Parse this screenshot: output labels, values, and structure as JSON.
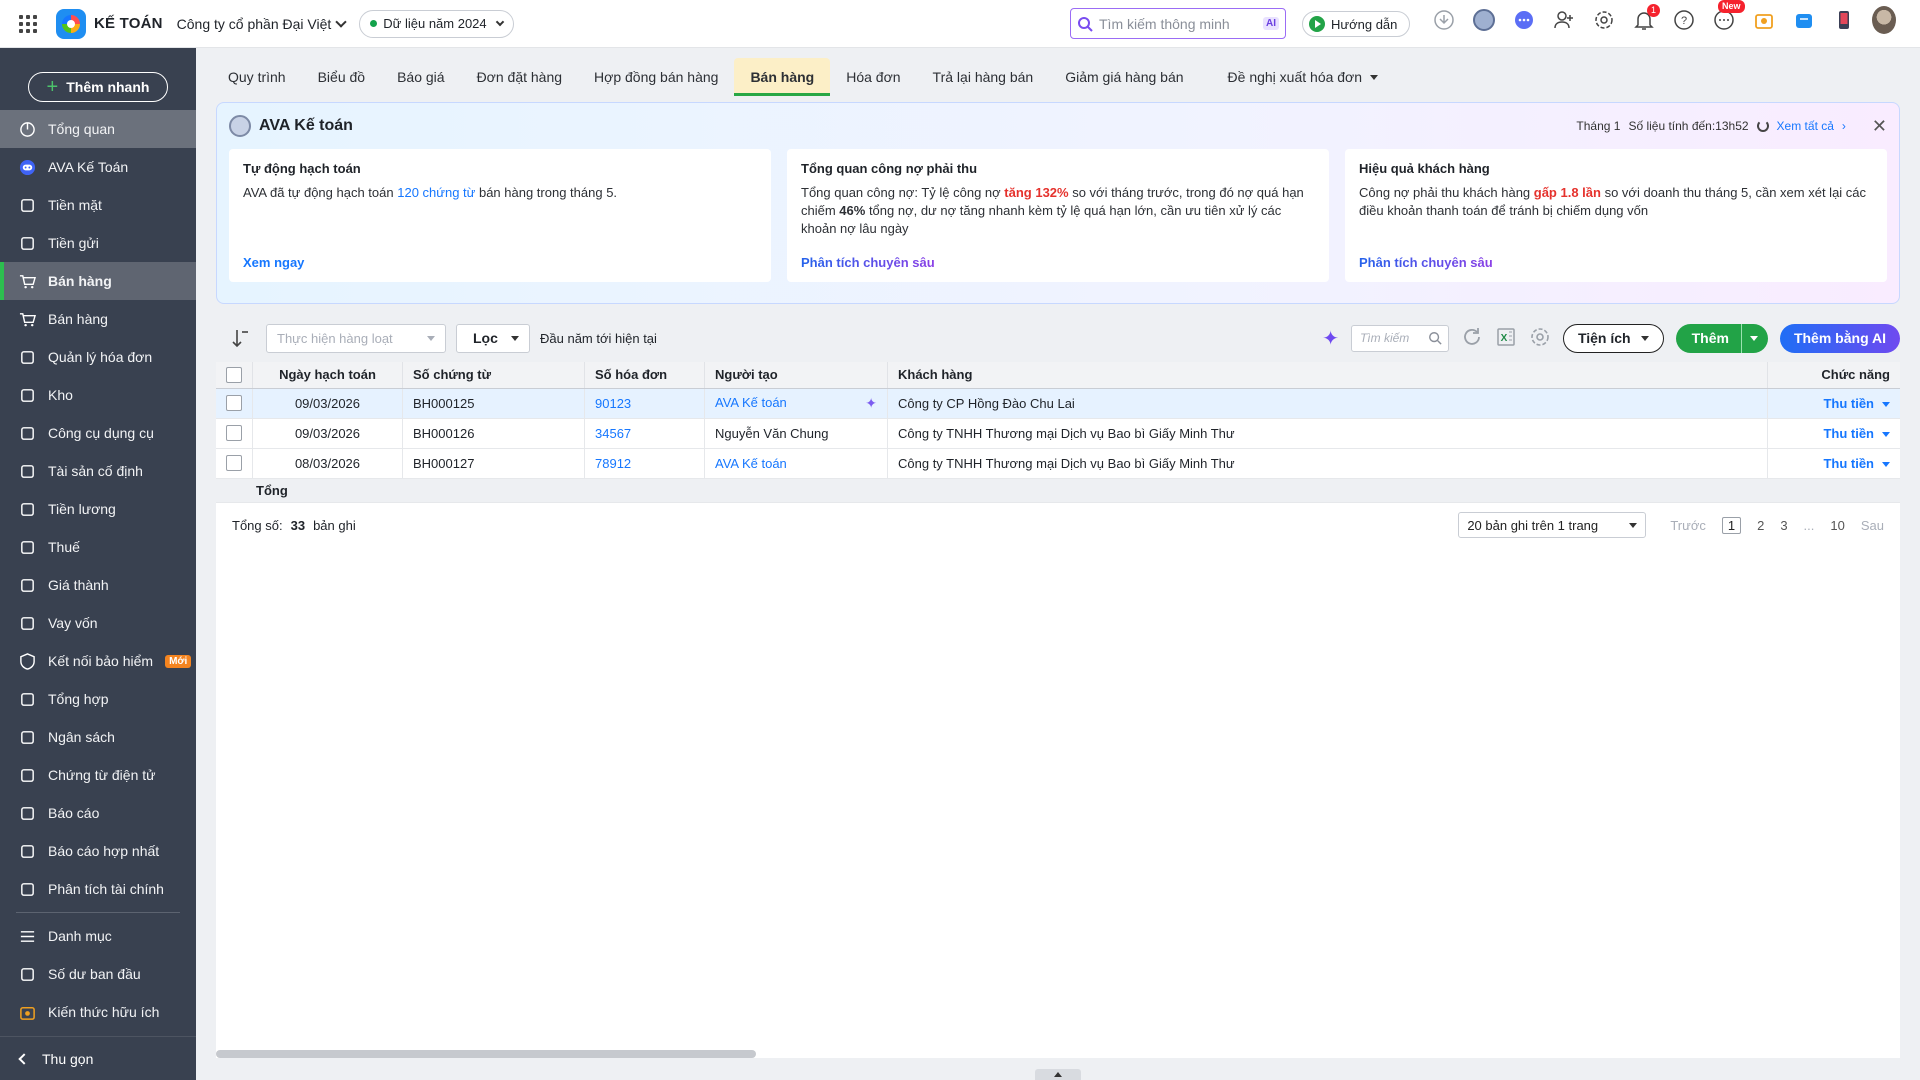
{
  "header": {
    "app_name": "KẾ TOÁN",
    "company": "Công ty cổ phần Đại Việt",
    "data_year": "Dữ liệu năm 2024",
    "search_placeholder": "Tìm kiếm thông minh",
    "search_ai_tag": "AI",
    "guide_label": "Hướng dẫn",
    "notification_count": "1",
    "new_badge": "New"
  },
  "sidebar": {
    "quick_add": "Thêm nhanh",
    "items": [
      {
        "label": "Tổng quan",
        "icon": "dashboard-icon"
      },
      {
        "label": "AVA Kế Toán",
        "icon": "ava-bot-icon"
      },
      {
        "label": "Tiền mặt",
        "icon": "cash-icon"
      },
      {
        "label": "Tiền gửi",
        "icon": "bank-icon"
      },
      {
        "label": "Bán hàng",
        "icon": "cart-icon"
      },
      {
        "label": "Bán hàng",
        "icon": "cart-icon"
      },
      {
        "label": "Quản lý hóa đơn",
        "icon": "invoice-icon"
      },
      {
        "label": "Kho",
        "icon": "warehouse-icon"
      },
      {
        "label": "Công cụ dụng cụ",
        "icon": "tools-icon"
      },
      {
        "label": "Tài sản cố định",
        "icon": "asset-icon"
      },
      {
        "label": "Tiền lương",
        "icon": "salary-icon"
      },
      {
        "label": "Thuế",
        "icon": "tax-icon"
      },
      {
        "label": "Giá thành",
        "icon": "price-tag-icon"
      },
      {
        "label": "Vay vốn",
        "icon": "loan-icon"
      },
      {
        "label": "Kết nối bảo hiểm",
        "icon": "shield-icon",
        "badge": "Mới"
      },
      {
        "label": "Tổng hợp",
        "icon": "summary-icon"
      },
      {
        "label": "Ngân sách",
        "icon": "budget-icon"
      },
      {
        "label": "Chứng từ điện tử",
        "icon": "e-document-icon"
      },
      {
        "label": "Báo cáo",
        "icon": "report-icon"
      },
      {
        "label": "Báo cáo hợp nhất",
        "icon": "consolidated-report-icon"
      },
      {
        "label": "Phân tích tài chính",
        "icon": "analytics-icon"
      },
      {
        "label": "Danh mục",
        "icon": "list-icon"
      },
      {
        "label": "Số dư ban đầu",
        "icon": "opening-balance-icon"
      },
      {
        "label": "Kiến thức hữu ích",
        "icon": "knowledge-icon"
      }
    ],
    "collapse": "Thu gọn"
  },
  "tabs": [
    "Quy trình",
    "Biểu đồ",
    "Báo giá",
    "Đơn đặt hàng",
    "Hợp đồng bán hàng",
    "Bán hàng",
    "Hóa đơn",
    "Trả lại hàng bán",
    "Giảm giá hàng bán",
    "Đề nghị xuất hóa đơn"
  ],
  "ava": {
    "title": "AVA Kế toán",
    "month": "Tháng 1",
    "as_of": "Số liệu tính đến:13h52",
    "view_all": "Xem tất cả",
    "cards": [
      {
        "title": "Tự động hạch toán",
        "t1": "AVA đã tự động hạch toán ",
        "hl": "120 chứng từ",
        "t2": " bán hàng trong tháng 5.",
        "link": "Xem ngay"
      },
      {
        "title": "Tổng quan công nợ phải thu",
        "t1": "Tổng quan công nợ: Tỷ lệ công nợ ",
        "hl": "tăng 132%",
        "t2": " so với tháng trước, trong đó nợ quá hạn chiếm ",
        "hl2": "46%",
        "t3": " tổng nợ, dư nợ tăng nhanh kèm tỷ lệ quá hạn lớn, cần ưu tiên xử lý các khoản nợ lâu ngày",
        "link": "Phân tích chuyên sâu"
      },
      {
        "title": "Hiệu quả khách hàng",
        "t1": "Công nợ phải thu khách hàng ",
        "hl": "gấp 1.8 lần",
        "t2": " so với doanh thu tháng 5, cần xem xét lại các điều khoản thanh toán để tránh bị chiếm dụng vốn",
        "link": "Phân tích chuyên sâu"
      }
    ]
  },
  "toolbar": {
    "batch_placeholder": "Thực hiện hàng loạt",
    "filter": "Lọc",
    "period": "Đầu năm tới hiện tại",
    "search_placeholder": "Tìm kiếm",
    "utilities": "Tiện ích",
    "add": "Thêm",
    "add_ai": "Thêm bằng AI"
  },
  "table": {
    "columns": [
      "Ngày hạch toán",
      "Số chứng từ",
      "Số hóa đơn",
      "Người tạo",
      "Khách hàng",
      "Chức năng"
    ],
    "rows": [
      {
        "date": "09/03/2026",
        "voucher": "BH000125",
        "invoice": "90123",
        "creator": "AVA Kế toán",
        "customer": "Công ty CP Hồng Đào Chu Lai",
        "action": "Thu tiền"
      },
      {
        "date": "09/03/2026",
        "voucher": "BH000126",
        "invoice": "34567",
        "creator": "Nguyễn Văn Chung",
        "customer": "Công ty TNHH Thương mại Dịch vụ Bao bì Giấy Minh Thư",
        "action": "Thu tiền"
      },
      {
        "date": "08/03/2026",
        "voucher": "BH000127",
        "invoice": "78912",
        "creator": "AVA Kế toán",
        "customer": "Công ty TNHH Thương mại Dịch vụ Bao bì Giấy Minh Thư",
        "action": "Thu tiền"
      }
    ],
    "total_label": "Tổng"
  },
  "footer": {
    "total_label": "Tổng số:",
    "total_value": "33",
    "records_label": "bản ghi",
    "per_page": "20 bản ghi trên 1 trang",
    "prev": "Trước",
    "pages": [
      "1",
      "2",
      "3",
      "...",
      "10"
    ],
    "next": "Sau"
  }
}
